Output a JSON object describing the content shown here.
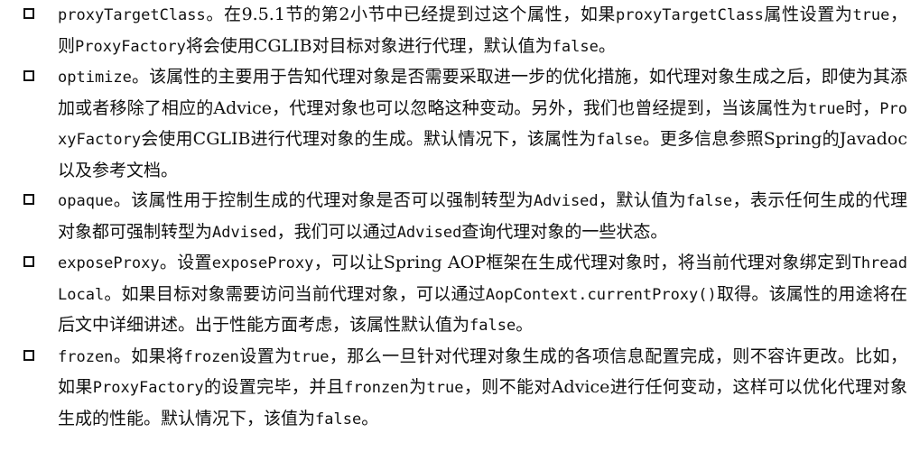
{
  "items": [
    {
      "segments": [
        {
          "t": "proxyTargetClass",
          "m": true
        },
        {
          "t": "。在9.5.1节的第2小节中已经提到过这个属性，如果",
          "m": false
        },
        {
          "t": "proxyTargetClass",
          "m": true
        },
        {
          "t": "属性设置为",
          "m": false
        },
        {
          "t": "true",
          "m": true
        },
        {
          "t": "，则",
          "m": false
        },
        {
          "t": "ProxyFactory",
          "m": true
        },
        {
          "t": "将会使用CGLIB对目标对象进行代理，默认值为",
          "m": false
        },
        {
          "t": "false",
          "m": true
        },
        {
          "t": "。",
          "m": false
        }
      ]
    },
    {
      "segments": [
        {
          "t": "optimize",
          "m": true
        },
        {
          "t": "。该属性的主要用于告知代理对象是否需要采取进一步的优化措施，如代理对象生成之后，即使为其添加或者移除了相应的Advice，代理对象也可以忽略这种变动。另外，我们也曾经提到，当该属性为",
          "m": false
        },
        {
          "t": "true",
          "m": true
        },
        {
          "t": "时，",
          "m": false
        },
        {
          "t": "ProxyFactory",
          "m": true
        },
        {
          "t": "会使用CGLIB进行代理对象的生成。默认情况下，该属性为",
          "m": false
        },
        {
          "t": "false",
          "m": true
        },
        {
          "t": "。更多信息参照Spring的Javadoc以及参考文档。",
          "m": false
        }
      ]
    },
    {
      "segments": [
        {
          "t": "opaque",
          "m": true
        },
        {
          "t": "。该属性用于控制生成的代理对象是否可以强制转型为",
          "m": false
        },
        {
          "t": "Advised",
          "m": true
        },
        {
          "t": "，默认值为",
          "m": false
        },
        {
          "t": "false",
          "m": true
        },
        {
          "t": "，表示任何生成的代理对象都可强制转型为",
          "m": false
        },
        {
          "t": "Advised",
          "m": true
        },
        {
          "t": "，我们可以通过",
          "m": false
        },
        {
          "t": "Advised",
          "m": true
        },
        {
          "t": "查询代理对象的一些状态。",
          "m": false
        }
      ]
    },
    {
      "segments": [
        {
          "t": "exposeProxy",
          "m": true
        },
        {
          "t": "。设置",
          "m": false
        },
        {
          "t": "exposeProxy",
          "m": true
        },
        {
          "t": "，可以让Spring AOP框架在生成代理对象时，将当前代理对象绑定到",
          "m": false
        },
        {
          "t": "ThreadLocal",
          "m": true
        },
        {
          "t": "。如果目标对象需要访问当前代理对象，可以通过",
          "m": false
        },
        {
          "t": "AopContext.currentProxy()",
          "m": true
        },
        {
          "t": "取得。该属性的用途将在后文中详细讲述。出于性能方面考虑，该属性默认值为",
          "m": false
        },
        {
          "t": "false",
          "m": true
        },
        {
          "t": "。",
          "m": false
        }
      ]
    },
    {
      "segments": [
        {
          "t": "frozen",
          "m": true
        },
        {
          "t": "。如果将",
          "m": false
        },
        {
          "t": "frozen",
          "m": true
        },
        {
          "t": "设置为",
          "m": false
        },
        {
          "t": "true",
          "m": true
        },
        {
          "t": "，那么一旦针对代理对象生成的各项信息配置完成，则不容许更改。比如，如果",
          "m": false
        },
        {
          "t": "ProxyFactory",
          "m": true
        },
        {
          "t": "的设置完毕，并且",
          "m": false
        },
        {
          "t": "fronzen",
          "m": true
        },
        {
          "t": "为",
          "m": false
        },
        {
          "t": "true",
          "m": true
        },
        {
          "t": "，则不能对Advice进行任何变动，这样可以优化代理对象生成的性能。默认情况下，该值为",
          "m": false
        },
        {
          "t": "false",
          "m": true
        },
        {
          "t": "。",
          "m": false
        }
      ]
    }
  ]
}
